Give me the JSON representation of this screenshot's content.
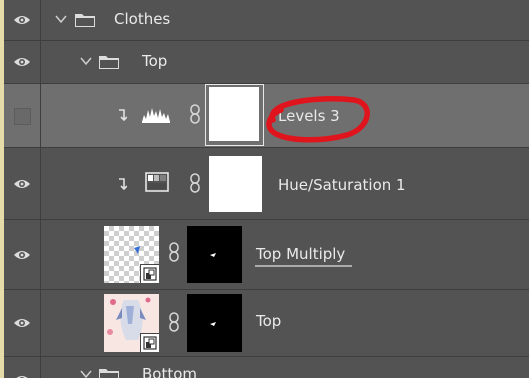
{
  "layers": [
    {
      "id": "clothes",
      "type": "group",
      "label": "Clothes",
      "visible": true
    },
    {
      "id": "top-group",
      "type": "group",
      "label": "Top",
      "visible": true
    },
    {
      "id": "levels",
      "type": "adjustment",
      "label": "Levels 3",
      "visible": false,
      "adjustment": "levels-icon",
      "selected": true,
      "annotated": true
    },
    {
      "id": "huesat",
      "type": "adjustment",
      "label": "Hue/Saturation 1",
      "visible": true,
      "adjustment": "hue-saturation-icon"
    },
    {
      "id": "top-multiply",
      "type": "smart-object",
      "label": "Top Multiply",
      "visible": true
    },
    {
      "id": "top-layer",
      "type": "smart-object",
      "label": "Top",
      "visible": true
    },
    {
      "id": "bottom",
      "type": "group",
      "label": "Bottom",
      "visible": true
    }
  ],
  "colors": {
    "panel_bg": "#535353",
    "selected_row_bg": "#6f6f6f",
    "annotation": "#e0141c"
  }
}
